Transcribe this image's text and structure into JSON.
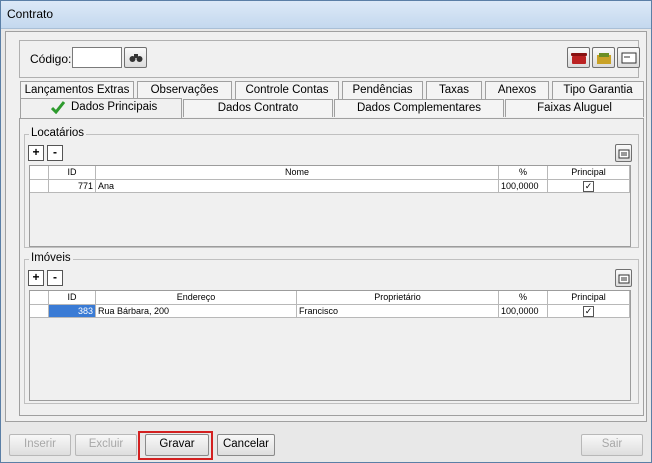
{
  "window": {
    "title": "Contrato"
  },
  "header": {
    "code_label": "Código:",
    "code_value": ""
  },
  "tabs_row1": [
    "Lançamentos Extras",
    "Observações",
    "Controle Contas",
    "Pendências",
    "Taxas",
    "Anexos",
    "Tipo Garantia"
  ],
  "tabs_row2": [
    "Dados Principais",
    "Dados Contrato",
    "Dados Complementares",
    "Faixas Aluguel"
  ],
  "locatarios": {
    "title": "Locatários",
    "add": "+",
    "remove": "-",
    "columns": [
      "ID",
      "Nome",
      "%",
      "Principal"
    ],
    "rows": [
      {
        "id": "771",
        "nome": "Ana",
        "pct": "100,0000",
        "principal": "✓"
      }
    ]
  },
  "imoveis": {
    "title": "Imóveis",
    "add": "+",
    "remove": "-",
    "columns": [
      "ID",
      "Endereço",
      "Proprietário",
      "%",
      "Principal"
    ],
    "rows": [
      {
        "id": "383",
        "endereco": "Rua Bárbara, 200",
        "proprietario": "Francisco",
        "pct": "100,0000",
        "principal": "✓"
      }
    ]
  },
  "buttons": {
    "inserir": "Inserir",
    "excluir": "Excluir",
    "gravar": "Gravar",
    "cancelar": "Cancelar",
    "sair": "Sair"
  },
  "icons": [
    "binoculars-icon",
    "phone-icon",
    "money-icon",
    "card-icon",
    "check-icon",
    "export-icon"
  ],
  "colors": {
    "highlight": "#d32020",
    "check": "#2e9b2e"
  }
}
